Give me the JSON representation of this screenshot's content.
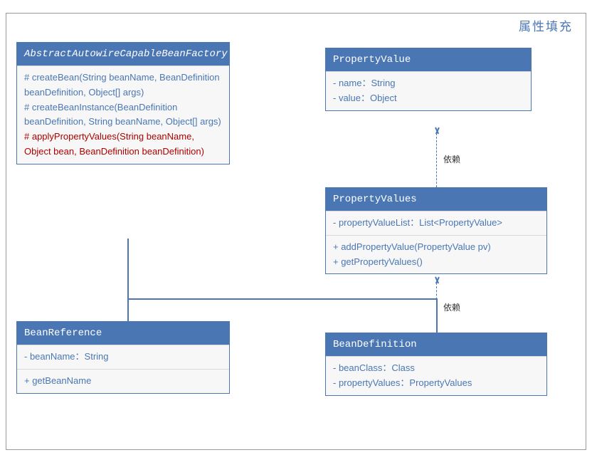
{
  "title": "属性填充",
  "classes": {
    "abstract": {
      "name": "AbstractAutowireCapableBeanFactory",
      "italic": true,
      "methods": [
        {
          "text": "# createBean(String beanName, BeanDefinition beanDefinition, Object[] args)",
          "highlight": false
        },
        {
          "text": "# createBeanInstance(BeanDefinition beanDefinition, String beanName, Object[] args)",
          "highlight": false
        },
        {
          "text": "# applyPropertyValues(String beanName, Object bean, BeanDefinition beanDefinition)",
          "highlight": true
        }
      ]
    },
    "propvalue": {
      "name": "PropertyValue",
      "fields": [
        {
          "text": "- name：String"
        },
        {
          "text": "- value：Object"
        }
      ]
    },
    "propvalues": {
      "name": "PropertyValues",
      "fields": [
        {
          "text": "- propertyValueList：List<PropertyValue>"
        }
      ],
      "methods": [
        {
          "text": "+ addPropertyValue(PropertyValue pv)"
        },
        {
          "text": "+ getPropertyValues()"
        }
      ]
    },
    "beanref": {
      "name": "BeanReference",
      "fields": [
        {
          "text": "- beanName：String"
        }
      ],
      "methods": [
        {
          "text": "+ getBeanName"
        }
      ]
    },
    "beandef": {
      "name": "BeanDefinition",
      "fields": [
        {
          "text": "- beanClass：Class"
        },
        {
          "text": "- propertyValues：PropertyValues"
        }
      ]
    }
  },
  "relations": {
    "dep1": "依赖",
    "dep2": "依赖"
  }
}
